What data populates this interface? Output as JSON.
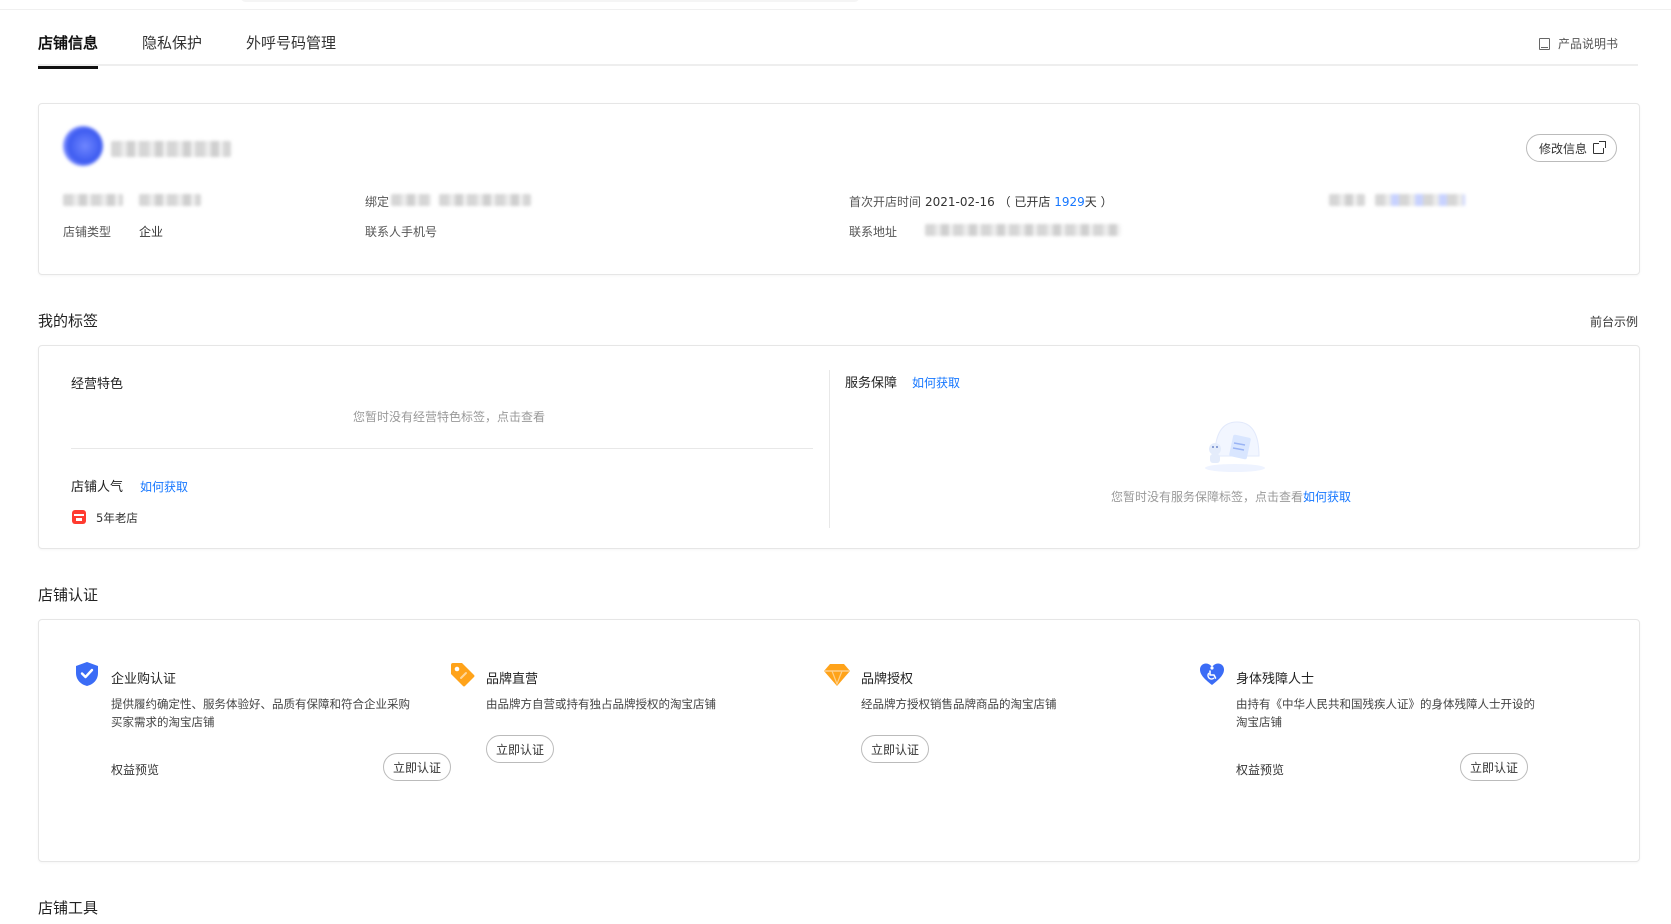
{
  "tabs": {
    "items": [
      {
        "label": "店铺信息",
        "active": true
      },
      {
        "label": "隐私保护",
        "active": false
      },
      {
        "label": "外呼号码管理",
        "active": false
      }
    ],
    "manual_label": "产品说明书"
  },
  "store_info": {
    "edit_label": "修改信息",
    "bind_label": "绑定",
    "store_type_label": "店铺类型",
    "store_type_value": "企业",
    "contact_phone_label": "联系人手机号",
    "first_open_label": "首次开店时间",
    "first_open_date": "2021-02-16",
    "open_prefix": "（ 已开店 ",
    "open_days": "1929",
    "open_suffix": "天 ）",
    "address_label": "联系地址"
  },
  "tags": {
    "section_title": "我的标签",
    "preview_label": "前台示例",
    "features_title": "经营特色",
    "features_empty": "您暂时没有经营特色标签，点击查看",
    "popularity_title": "店铺人气",
    "how_to_get": "如何获取",
    "popularity_badge": "5年老店",
    "service_title": "服务保障",
    "service_empty": "您暂时没有服务保障标签，点击查看",
    "service_empty_link": "如何获取"
  },
  "certification": {
    "section_title": "店铺认证",
    "items": [
      {
        "title": "企业购认证",
        "desc": "提供履约确定性、服务体验好、品质有保障和符合企业采购买家需求的淘宝店铺",
        "link": "权益预览",
        "button": "立即认证",
        "icon": "shield-check-icon",
        "color": "#3b6cf6"
      },
      {
        "title": "品牌直营",
        "desc": "由品牌方自营或持有独占品牌授权的淘宝店铺",
        "button": "立即认证",
        "icon": "tag-icon",
        "color": "#ffa31a"
      },
      {
        "title": "品牌授权",
        "desc": "经品牌方授权销售品牌商品的淘宝店铺",
        "button": "立即认证",
        "icon": "diamond-icon",
        "color": "#ffa31a"
      },
      {
        "title": "身体残障人士",
        "desc": "由持有《中华人民共和国残疾人证》的身体残障人士开设的淘宝店铺",
        "link": "权益预览",
        "button": "立即认证",
        "icon": "accessibility-heart-icon",
        "color": "#3b6cf6"
      }
    ]
  },
  "tools": {
    "section_title": "店铺工具"
  }
}
